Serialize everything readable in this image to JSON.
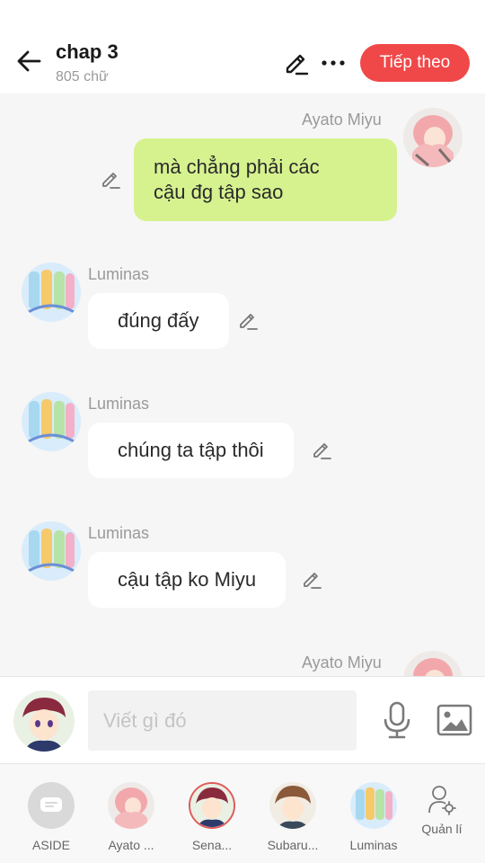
{
  "header": {
    "title": "chap 3",
    "subtitle": "805 chữ",
    "next_label": "Tiếp theo"
  },
  "messages": [
    {
      "side": "right",
      "sender": "Ayato  Miyu",
      "text_line1": "mà chẳng phải các",
      "text_line2": "cậu đg tập sao"
    },
    {
      "side": "left",
      "sender": "Luminas",
      "text": "đúng đấy"
    },
    {
      "side": "left",
      "sender": "Luminas",
      "text": "chúng ta tập thôi"
    },
    {
      "side": "left",
      "sender": "Luminas",
      "text": "cậu tập ko Miyu"
    },
    {
      "side": "right",
      "sender": "Ayato  Miyu"
    }
  ],
  "input": {
    "placeholder": "Viết gì đó"
  },
  "nav": {
    "items": [
      {
        "label": "ASIDE",
        "icon": "chat-bubble-icon"
      },
      {
        "label": "Ayato ...",
        "icon": "avatar-ayato"
      },
      {
        "label": "Sena...",
        "icon": "avatar-sena"
      },
      {
        "label": "Subaru...",
        "icon": "avatar-subaru"
      },
      {
        "label": "Luminas",
        "icon": "avatar-luminas"
      },
      {
        "label": "Quản lí",
        "icon": "user-settings-icon"
      }
    ]
  },
  "colors": {
    "accent": "#f04849",
    "my_bubble": "#d6f28f",
    "their_bubble": "#ffffff",
    "background": "#f6f6f6"
  }
}
